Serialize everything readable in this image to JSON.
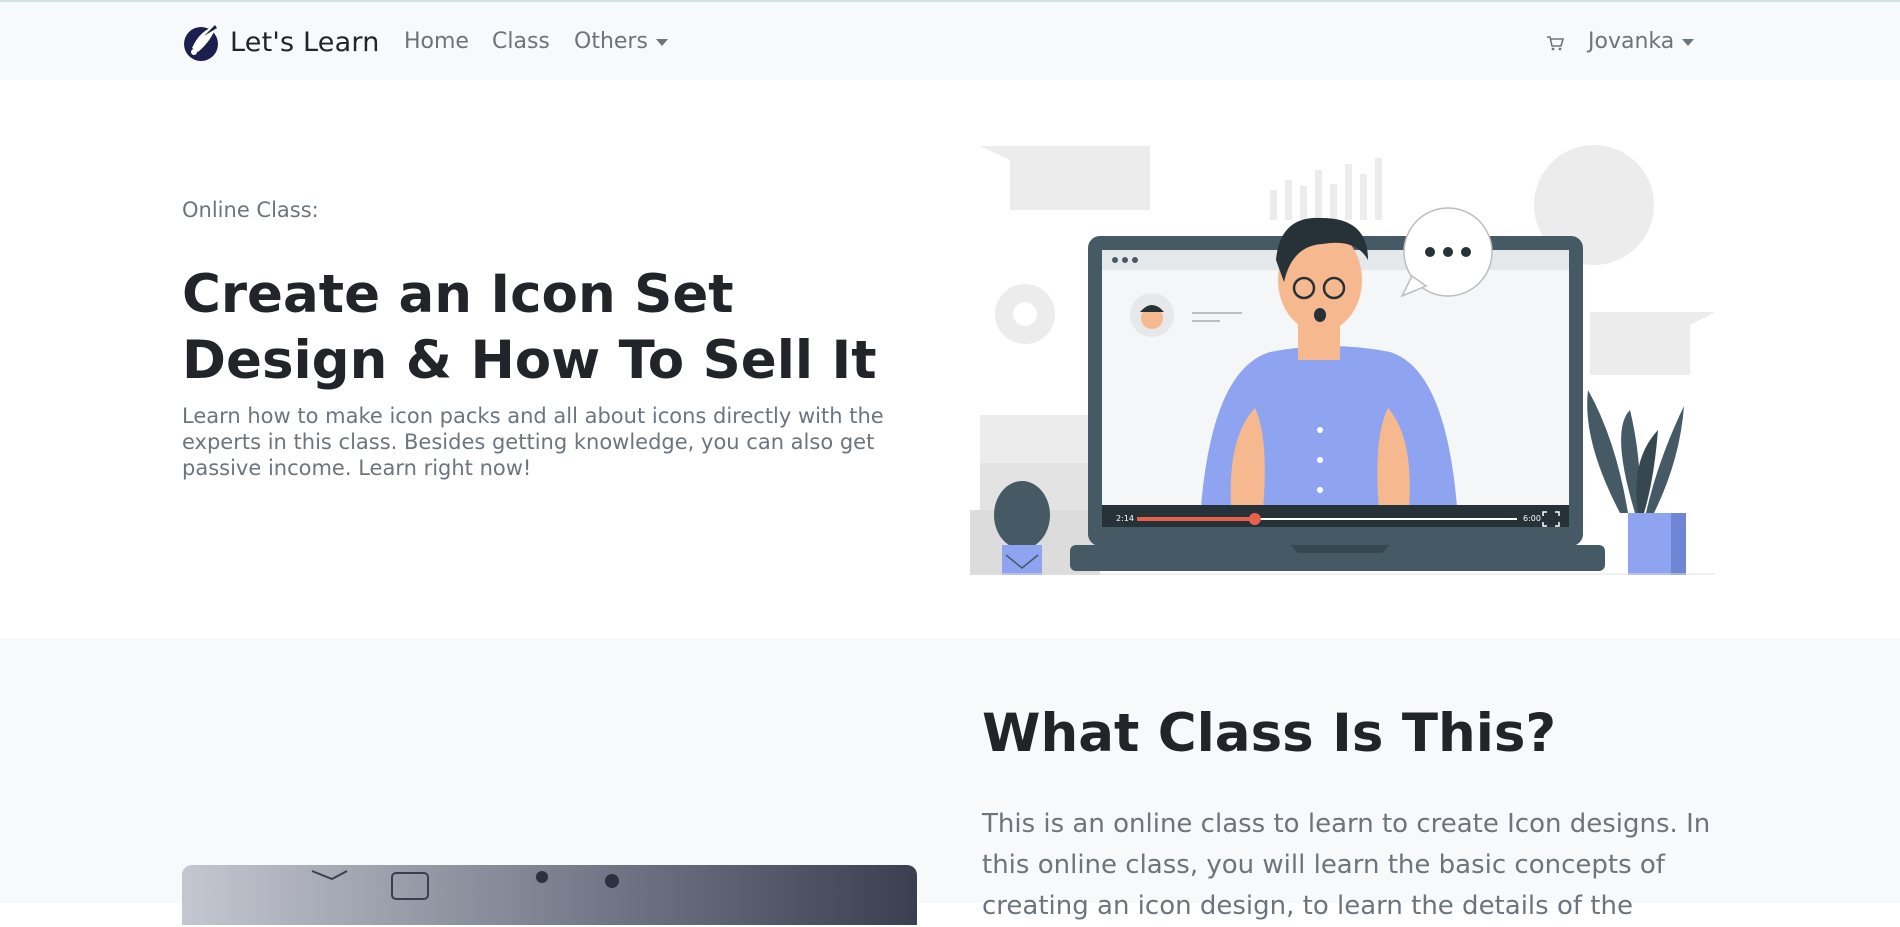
{
  "navbar": {
    "brand": "Let's Learn",
    "links": [
      {
        "label": "Home"
      },
      {
        "label": "Class"
      },
      {
        "label": "Others"
      }
    ],
    "cart_icon": "cart-icon",
    "user": "Jovanka"
  },
  "hero": {
    "eyebrow": "Online Class:",
    "title": "Create an Icon Set Design & How To Sell It",
    "description": "Learn how to make icon packs and all about icons directly with the experts in this class. Besides getting knowledge, you can also get passive income. Learn right now!",
    "video_player": {
      "current_time": "2:14",
      "duration": "6:00",
      "progress": 0.31
    }
  },
  "about": {
    "title": "What Class Is This?",
    "text": "This is an online class to learn to create Icon designs. In this online class, you will learn the basic concepts of creating an icon design, to learn the details of the"
  },
  "colors": {
    "accent": "#e8604c",
    "primary_blue": "#8ea4f0",
    "laptop": "#455a64",
    "navbar_bg": "#f8f9fa",
    "section_bg": "#f8f9fa"
  }
}
